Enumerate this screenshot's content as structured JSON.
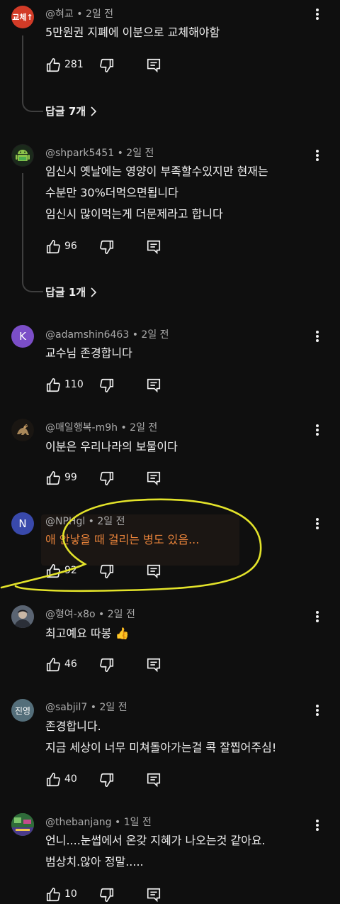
{
  "comments": [
    {
      "avatar_text": "교체↑",
      "avatar_color": "#d23b27",
      "handle": "@혀교",
      "time": "2일 전",
      "lines": [
        "5만원권 지폐에 이분으로 교체해야함"
      ],
      "likes": "281",
      "replies_label": "답글 7개"
    },
    {
      "avatar_text": "",
      "avatar_color": "#1e1e1e",
      "avatar_icon": "android-robot-icon",
      "handle": "@shpark5451",
      "time": "2일 전",
      "lines": [
        "임신시 옛날에는 영양이 부족할수있지만 현재는",
        "수분만 30%더먹으면됩니다",
        "임신시 많이먹는게 더문제라고 합니다"
      ],
      "likes": "96",
      "replies_label": "답글 1개"
    },
    {
      "avatar_text": "K",
      "avatar_color": "#7b4ec7",
      "handle": "@adamshin6463",
      "time": "2일 전",
      "lines": [
        "교수님 존경합니다"
      ],
      "likes": "110"
    },
    {
      "avatar_text": "",
      "avatar_color": "#101010",
      "avatar_icon": "dog-photo-icon",
      "handle": "@매일행복-m9h",
      "time": "2일 전",
      "lines": [
        "이분은 우리나라의 보물이다"
      ],
      "likes": "99"
    },
    {
      "avatar_text": "N",
      "avatar_color": "#3949ab",
      "handle": "@NPHgl",
      "time": "2일 전",
      "lines": [
        "애 안낳을 때 걸리는 병도 있음..."
      ],
      "likes": "92",
      "highlight_color": "#e8833a"
    },
    {
      "avatar_text": "",
      "avatar_color": "#3a3f4a",
      "avatar_icon": "person-photo-icon",
      "handle": "@형여-x8o",
      "time": "2일 전",
      "lines": [
        "최고예요 따봉 👍"
      ],
      "likes": "46"
    },
    {
      "avatar_text": "진영",
      "avatar_color": "#546e7a",
      "handle": "@sabjil7",
      "time": "2일 전",
      "lines": [
        "존경합니다.",
        "지금 세상이 너무 미쳐돌아가는걸 콕 잘찝어주심!"
      ],
      "likes": "40"
    },
    {
      "avatar_text": "",
      "avatar_color": "#2e7d32",
      "avatar_icon": "game-screenshot-icon",
      "handle": "@thebanjang",
      "time": "1일 전",
      "lines": [
        "언니....눈썹에서 온갖 지혜가 나오는것 같아요.",
        "범상치.않아 정말....."
      ],
      "likes": "10"
    }
  ],
  "colors": {
    "background": "#0f0f0f",
    "annotation": "#e3e32a",
    "thread_line": "#3f3f3f",
    "meta_text": "#aaaaaa"
  }
}
